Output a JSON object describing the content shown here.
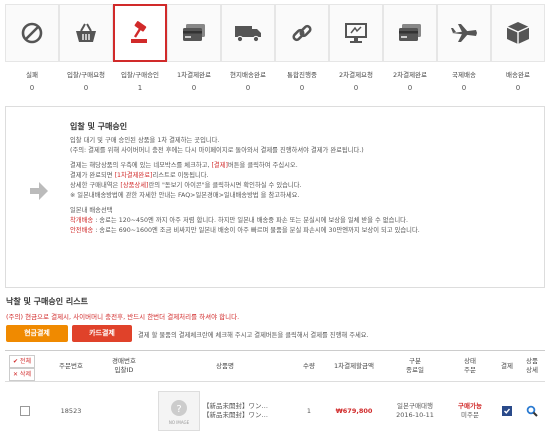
{
  "steps": [
    {
      "label": "실패",
      "count": "0",
      "icon": "ban-icon"
    },
    {
      "label": "입찰/구매요청",
      "count": "0",
      "icon": "basket-icon"
    },
    {
      "label": "입찰/구매승인",
      "count": "1",
      "icon": "gavel-icon",
      "active": true
    },
    {
      "label": "1차결제완료",
      "count": "0",
      "icon": "card-icon"
    },
    {
      "label": "현지배송완료",
      "count": "0",
      "icon": "truck-icon"
    },
    {
      "label": "통합진행중",
      "count": "0",
      "icon": "link-icon"
    },
    {
      "label": "2차결제요청",
      "count": "0",
      "icon": "monitor-icon"
    },
    {
      "label": "2차결제완료",
      "count": "0",
      "icon": "card-icon"
    },
    {
      "label": "국제배송",
      "count": "0",
      "icon": "airplane-icon"
    },
    {
      "label": "배송완료",
      "count": "0",
      "icon": "box-icon"
    }
  ],
  "info": {
    "title": "입찰 및 구매승인",
    "line1": "입찰 대기 및 구매 승인된 상품을 1차 결제하는 곳입니다.",
    "line2": "(주의: 결제를 위해 사이버머니 충전 후에는 다시 마이페이지로 돌아와서 결제를 진행하셔야 결제가 완료됩니다.)",
    "line3a": "결제는 해당상품의 우측에 있는 네모박스를 체크하고, ",
    "line3b": "[결제]",
    "line3c": "버튼을 클릭하여 주십시오.",
    "line4a": "결제가 완료되면 ",
    "line4b": "[1차결제완료]",
    "line4c": "리스트로 이동됩니다.",
    "line5a": "상세한 구매내역은 ",
    "line5b": "[상품상세]",
    "line5c": "란의 \"돋보기 아이콘\"을 클릭하시면 확인하실 수 있습니다.",
    "line6": "※ 일본내배송방법에 관한 자세한 안내는 FAQ>일본경매>일내배송방법 을 참고하세요.",
    "line7": "일본내 배송선택",
    "line8a": "착개배송",
    "line8b": " : 송료는 120~450엔 까지 아주 저렴 합니다. 하지만 일본내 배송중 파손 또는 분실시에 보상을 일체 받을 수 없습니다.",
    "line9a": "안전배송",
    "line9b": " : 송료는 690~1600엔 조금 비싸지만 일본내 배송이 아주 빠르며 물품을 분실 파손시에 30만엔까지 보상이 되고 있습니다."
  },
  "list": {
    "title": "낙찰 및 구매승인 리스트",
    "notice": "(주의) 현금으로 결제시, 사이버머니 충전후, 반드시 한번더 결제처리를 하셔야 합니다.",
    "cash_button": "현금결제",
    "card_button": "카드결제",
    "button_desc": "결제 할 물품의 결제체크란에 체크해 주시고 결제버튼을 클릭해서 결제를 진행해 주세요."
  },
  "table": {
    "select_all": "✔ 전체",
    "delete": "✕ 삭제",
    "headers": {
      "order_no": "주문번호",
      "bid_id_1": "경매번호",
      "bid_id_2": "입찰ID",
      "product": "상품명",
      "qty": "수량",
      "first_payment": "1차결제할금액",
      "type_1": "구분",
      "type_2": "종료일",
      "status_1": "상태",
      "status_2": "주문",
      "pay": "결제",
      "detail_1": "상품",
      "detail_2": "상세"
    },
    "rows": [
      {
        "order_no": "18523",
        "bid_id": "",
        "product_line1": "【新品未開封】ワン…",
        "product_line2": "【新品未開封】ワン…",
        "thumb_label": "NO IMAGE",
        "qty": "1",
        "amount": "₩679,800",
        "type": "일본구매대행",
        "date": "2016-10-11",
        "status": "구매가능",
        "status_sub": "미주문"
      }
    ]
  },
  "colors": {
    "accent": "#d12a2a",
    "cash": "#f08a00",
    "card": "#e0422a",
    "link": "#2a7ad1"
  }
}
